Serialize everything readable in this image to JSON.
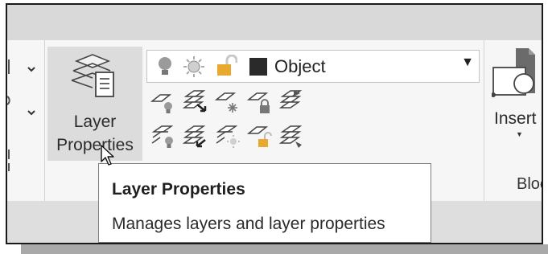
{
  "layers_panel": {
    "layer_properties_button": {
      "line1": "Layer",
      "line2": "Properties"
    },
    "current_layer": {
      "name": "Object",
      "color": "#2a2a2a"
    }
  },
  "insert": {
    "label": "Insert"
  },
  "blocks_panel": {
    "label_partial": "Bloc"
  },
  "tooltip": {
    "title": "Layer Properties",
    "description": "Manages layers and layer properties"
  },
  "colors": {
    "ribbon": "#f6f6f6",
    "band": "#d9d9d9",
    "button_hover": "#dcdcdc",
    "lock_icon": "#e8a92e",
    "sun_icon": "#c8c8c8",
    "bulb_icon": "#9a9a9a"
  }
}
